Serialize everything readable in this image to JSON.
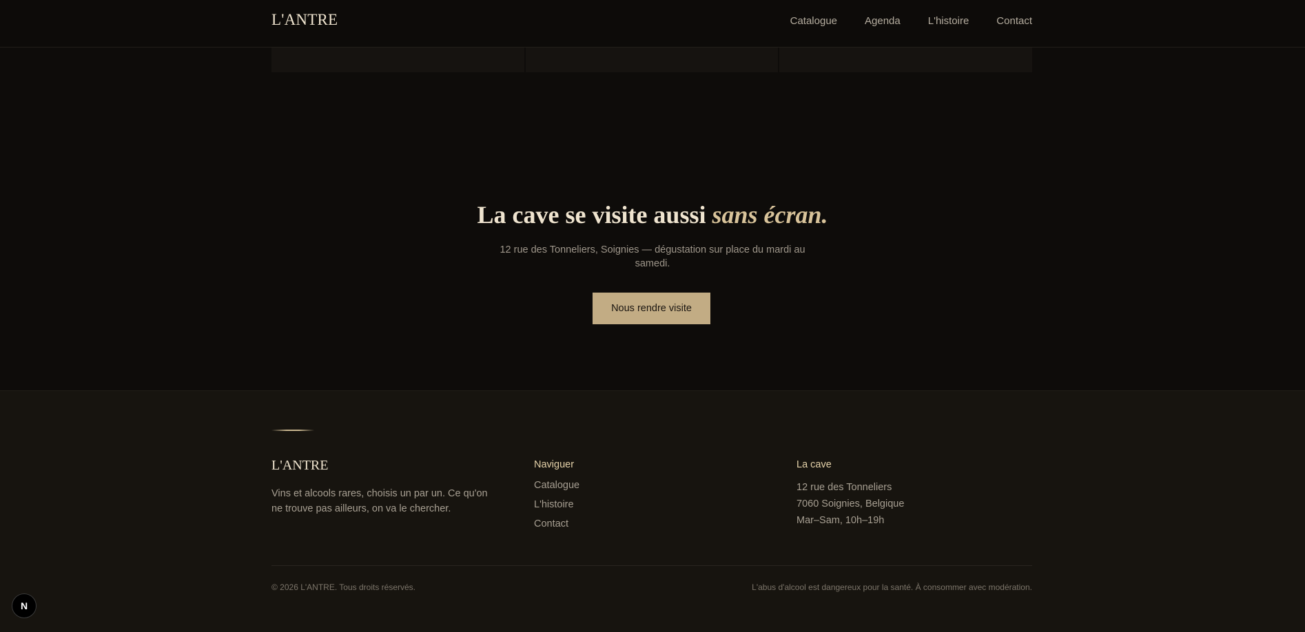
{
  "header": {
    "logo": "L'ANTRE",
    "nav": [
      "Catalogue",
      "Agenda",
      "L'histoire",
      "Contact"
    ]
  },
  "hero": {
    "title_main": "La cave se visite aussi ",
    "title_accent": "sans écran.",
    "subtitle": "12 rue des Tonneliers, Soignies — dégustation sur place du mardi au samedi.",
    "button": "Nous rendre visite"
  },
  "footer": {
    "brand": "L'ANTRE",
    "tagline": "Vins et alcools rares, choisis un par un. Ce qu'on ne trouve pas ailleurs, on va le chercher.",
    "nav_heading": "Naviguer",
    "nav_links": [
      "Catalogue",
      "L'histoire",
      "Contact"
    ],
    "cave_heading": "La cave",
    "cave_lines": [
      "12 rue des Tonneliers",
      "7060 Soignies, Belgique",
      "Mar–Sam, 10h–19h"
    ],
    "copyright": "© 2026 L'ANTRE. Tous droits réservés.",
    "warning": "L'abus d'alcool est dangereux pour la santé. À consommer avec modération."
  },
  "badge": {
    "letter": "N"
  },
  "colors": {
    "background": "#0e0c0a",
    "footer_bg": "#17140f",
    "accent_gold": "#c2ac84",
    "title_cream": "#efe4cf"
  }
}
